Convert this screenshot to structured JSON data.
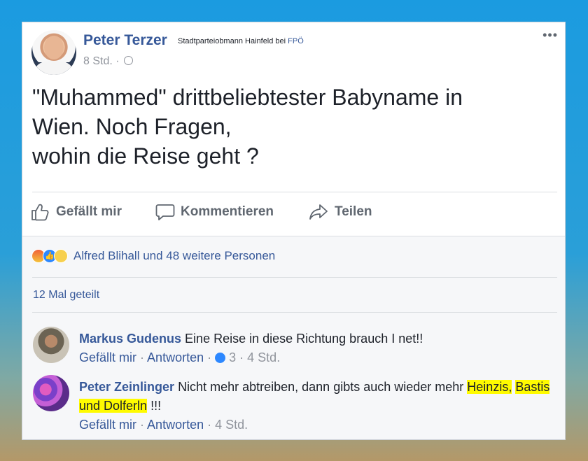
{
  "post": {
    "author": "Peter Terzer",
    "role_text": "Stadtparteiobmann Hainfeld bei",
    "party": "FPÖ",
    "time": "8 Std. ·",
    "more": "•••",
    "text_lines": [
      "\"Muhammed\" drittbeliebtester Babyname in",
      "Wien. Noch Fragen,",
      "wohin die Reise geht ?"
    ]
  },
  "actions": {
    "like": "Gefällt mir",
    "comment": "Kommentieren",
    "share": "Teilen"
  },
  "reactions": {
    "icons": [
      "angry-icon",
      "like-icon",
      "sad-icon"
    ],
    "summary": "Alfred Blihall und 48 weitere Personen"
  },
  "shares": "12 Mal geteilt",
  "comments": [
    {
      "author": "Markus Gudenus",
      "text": "Eine Reise in diese Richtung brauch I net!!",
      "like_label": "Gefällt mir",
      "reply_label": "Antworten",
      "reaction_count": "3",
      "time": "· 4 Std."
    },
    {
      "author": "Peter Zeinlinger",
      "text_before": "Nicht mehr abtreiben, dann gibts auch wieder mehr",
      "highlight_1": "Heinzis,",
      "highlight_2": "Bastis und Dolferln",
      "text_after": "!!!",
      "like_label": "Gefällt mir",
      "reply_label": "Antworten",
      "time": "· 4 Std."
    }
  ],
  "colors": {
    "link": "#365899",
    "muted": "#90949c",
    "highlight": "#fffb00"
  }
}
